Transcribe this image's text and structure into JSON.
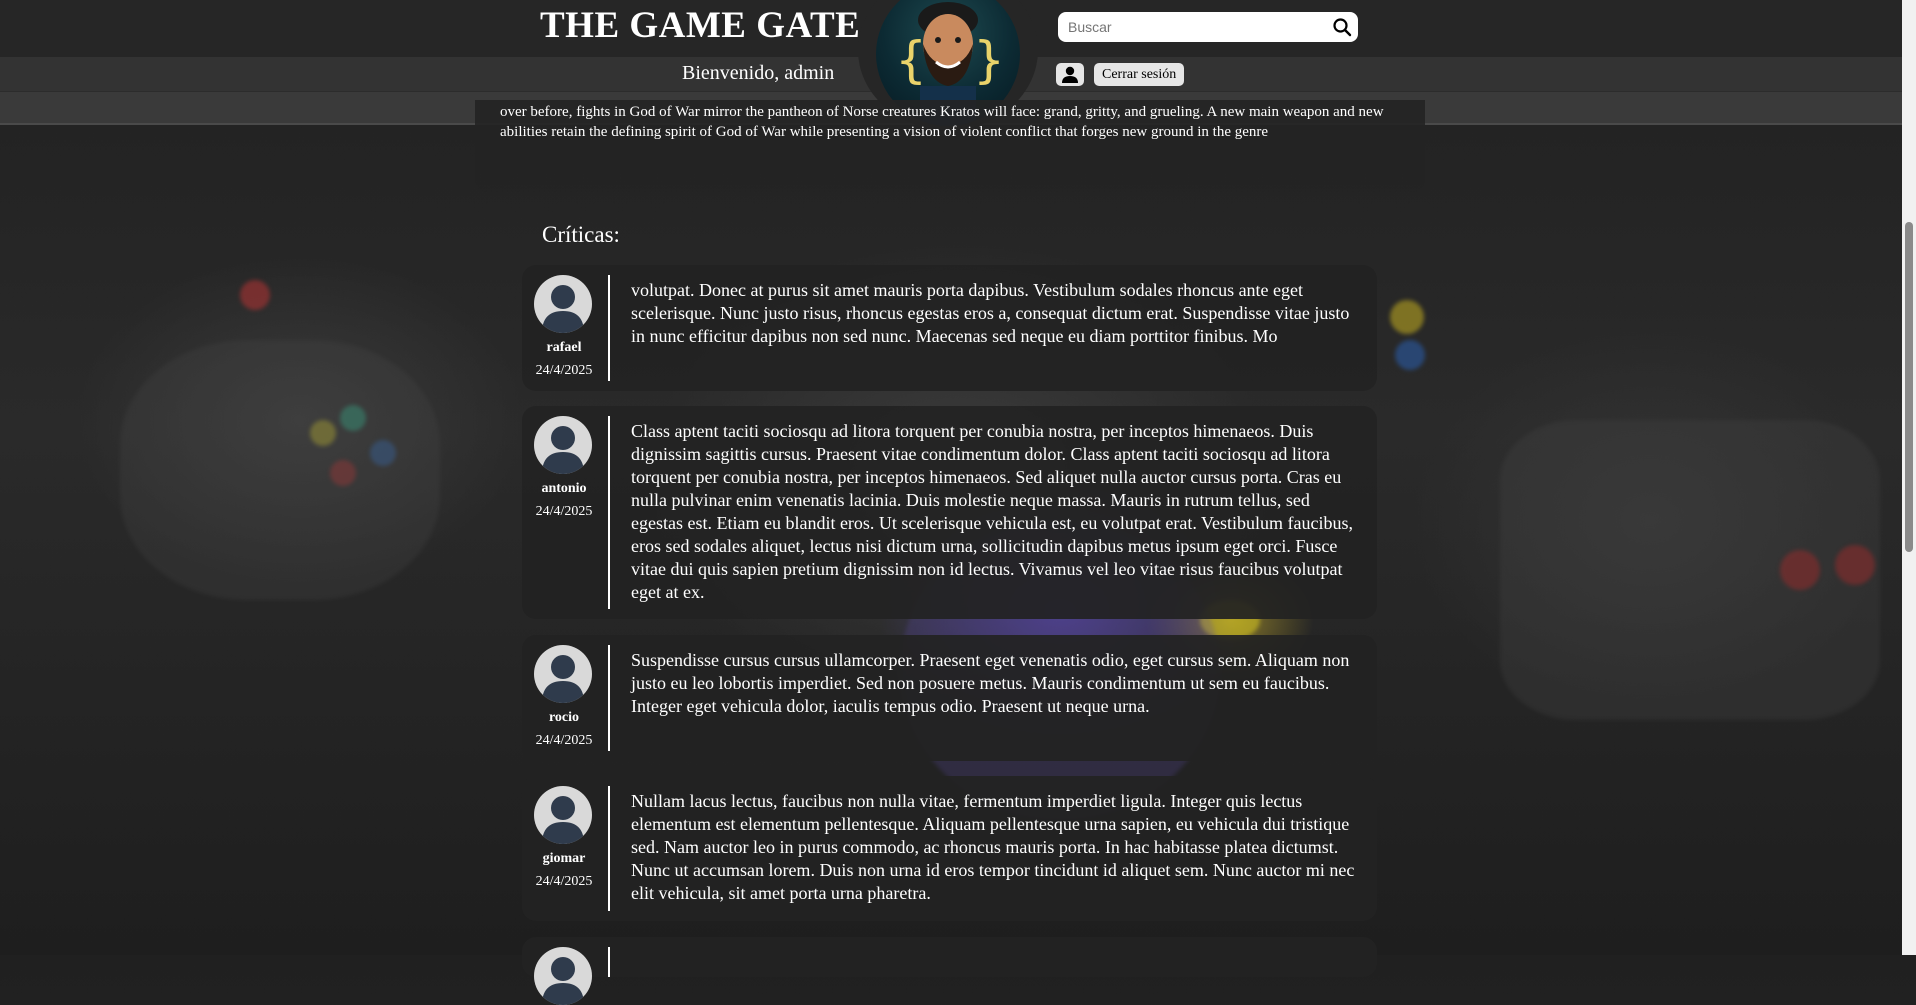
{
  "header": {
    "title": "THE GAME GATE",
    "welcome": "Bienvenido, admin",
    "search_placeholder": "Buscar",
    "logout_label": "Cerrar sesión"
  },
  "game": {
    "description": "over before, fights in God of War mirror the pantheon of Norse creatures Kratos will face: grand, gritty, and grueling. A new main weapon and new abilities retain the defining spirit of God of War while presenting a vision of violent conflict that forges new ground in the genre"
  },
  "reviews_title": "Críticas:",
  "reviews": [
    {
      "user": "rafael",
      "date": "24/4/2025",
      "text": "volutpat. Donec at purus sit amet mauris porta dapibus. Vestibulum sodales rhoncus ante eget scelerisque. Nunc justo risus, rhoncus egestas eros a, consequat dictum erat. Suspendisse vitae justo in nunc efficitur dapibus non sed nunc. Maecenas sed neque eu diam porttitor finibus. Mo"
    },
    {
      "user": "antonio",
      "date": "24/4/2025",
      "text": "Class aptent taciti sociosqu ad litora torquent per conubia nostra, per inceptos himenaeos. Duis dignissim sagittis cursus. Praesent vitae condimentum dolor. Class aptent taciti sociosqu ad litora torquent per conubia nostra, per inceptos himenaeos. Sed aliquet nulla auctor cursus porta. Cras eu nulla pulvinar enim venenatis lacinia. Duis molestie neque massa. Mauris in rutrum tellus, sed egestas est. Etiam eu blandit eros. Ut scelerisque vehicula est, eu volutpat erat. Vestibulum faucibus, eros sed sodales aliquet, lectus nisi dictum urna, sollicitudin dapibus metus ipsum eget orci. Fusce vitae dui quis sapien pretium dignissim non id lectus. Vivamus vel leo vitae risus faucibus volutpat eget at ex."
    },
    {
      "user": "rocio",
      "date": "24/4/2025",
      "text": "Suspendisse cursus cursus ullamcorper. Praesent eget venenatis odio, eget cursus sem. Aliquam non justo eu leo lobortis imperdiet. Sed non posuere metus. Mauris condimentum ut sem eu faucibus. Integer eget vehicula dolor, iaculis tempus odio. Praesent ut neque urna."
    },
    {
      "user": "giomar",
      "date": "24/4/2025",
      "text": "Nullam lacus lectus, faucibus non nulla vitae, fermentum imperdiet ligula. Integer quis lectus elementum est elementum pellentesque. Aliquam pellentesque urna sapien, eu vehicula dui tristique sed. Nam auctor leo in purus commodo, ac rhoncus mauris porta. In hac habitasse platea dictumst. Nunc ut accumsan lorem. Duis non urna id eros tempor tincidunt id aliquet sem. Nunc auctor mi nec elit vehicula, sit amet porta urna pharetra."
    },
    {
      "user": "",
      "date": "",
      "text": ""
    }
  ]
}
